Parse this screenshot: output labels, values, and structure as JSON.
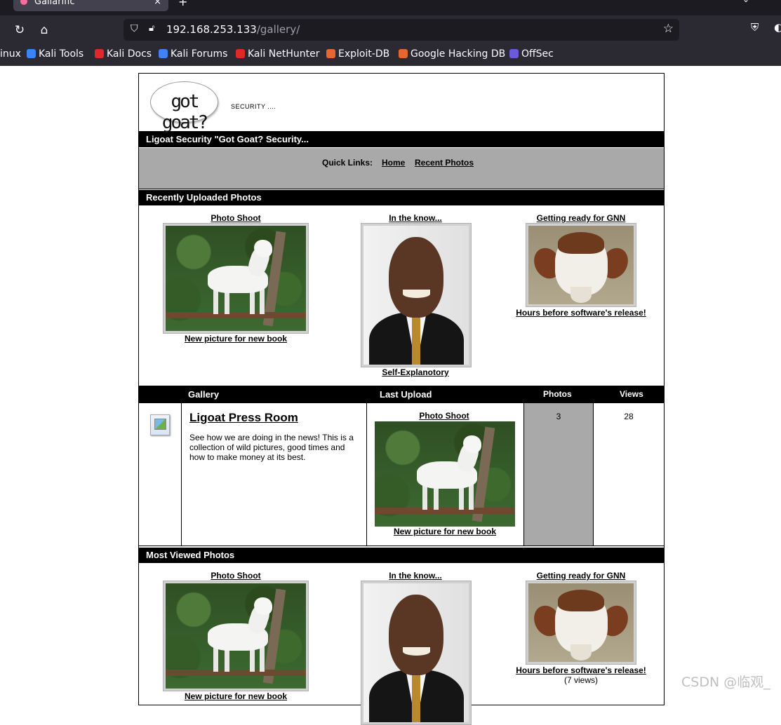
{
  "browser": {
    "tab_title": "Gallarific",
    "tab_close": "×",
    "new_tab": "+",
    "url_host": "192.168.253.133",
    "url_path": "/gallery/",
    "bookmarks": [
      {
        "label": "inux",
        "color": "#2b2a33"
      },
      {
        "label": "Kali Tools",
        "color": "#3e82f7"
      },
      {
        "label": "Kali Docs",
        "color": "#e0282a"
      },
      {
        "label": "Kali Forums",
        "color": "#3e82f7"
      },
      {
        "label": "Kali NetHunter",
        "color": "#e0282a"
      },
      {
        "label": "Exploit-DB",
        "color": "#e5662f"
      },
      {
        "label": "Google Hacking DB",
        "color": "#e5662f"
      },
      {
        "label": "OffSec",
        "color": "#6b5bd6"
      }
    ]
  },
  "site": {
    "logo_text": "got goat?",
    "logo_tagline": "SECURITY ....",
    "title_bar": "Ligoat Security \"Got Goat? Security...",
    "quick_links_label": "Quick Links:",
    "quick_links": [
      "Home",
      "Recent Photos"
    ]
  },
  "recent": {
    "heading": "Recently Uploaded Photos",
    "photos": [
      {
        "title": "Photo Shoot",
        "caption": "New picture for new book"
      },
      {
        "title": "In the know...",
        "caption": "Self-Explanotory"
      },
      {
        "title": "Getting ready for GNN",
        "caption": "Hours before software's release!"
      }
    ]
  },
  "gallery": {
    "headers": {
      "gallery": "Gallery",
      "last_upload": "Last Upload",
      "photos": "Photos",
      "views": "Views"
    },
    "album": {
      "name": "Ligoat Press Room",
      "description": "See how we are doing in the news! This is a collection of wild pictures, good times and how to make money at its best.",
      "last_title": "Photo Shoot",
      "last_caption": "New picture for new book",
      "photos": "3",
      "views": "28"
    }
  },
  "most_viewed": {
    "heading": "Most Viewed Photos",
    "photos": [
      {
        "title": "Photo Shoot",
        "caption": "New picture for new book"
      },
      {
        "title": "In the know...",
        "caption": ""
      },
      {
        "title": "Getting ready for GNN",
        "caption": "Hours before software's release!",
        "views": "(7 views)"
      }
    ]
  },
  "watermark": "CSDN @临观_"
}
